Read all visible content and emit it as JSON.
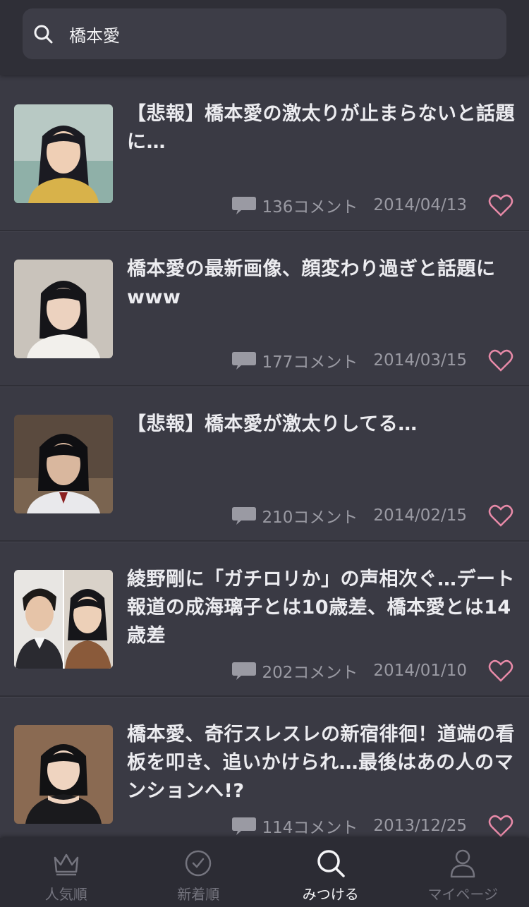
{
  "search": {
    "query": "橋本愛"
  },
  "articles": [
    {
      "title": "【悲報】橋本愛の激太りが止まらないと話題に…",
      "comments": "136コメント",
      "date": "2014/04/13"
    },
    {
      "title": "橋本愛の最新画像、顔変わり過ぎと話題にwww",
      "comments": "177コメント",
      "date": "2014/03/15"
    },
    {
      "title": "【悲報】橋本愛が激太りしてる…",
      "comments": "210コメント",
      "date": "2014/02/15"
    },
    {
      "title": "綾野剛に「ガチロリか」の声相次ぐ…デート報道の成海璃子とは10歳差、橋本愛とは14歳差",
      "comments": "202コメント",
      "date": "2014/01/10"
    },
    {
      "title": "橋本愛、奇行スレスレの新宿徘徊！道端の看板を叩き、追いかけられ…最後はあの人のマンションへ!?",
      "comments": "114コメント",
      "date": "2013/12/25"
    }
  ],
  "tabs": [
    {
      "label": "人気順",
      "icon": "crown-icon",
      "active": false
    },
    {
      "label": "新着順",
      "icon": "clock-icon",
      "active": false
    },
    {
      "label": "みつける",
      "icon": "search-icon",
      "active": true
    },
    {
      "label": "マイページ",
      "icon": "person-icon",
      "active": false
    }
  ],
  "colors": {
    "background": "#3a3a44",
    "header": "#2f2f37",
    "heart": "#e88aa8",
    "meta": "#9a9aa3",
    "active_tab": "#f5f5f7",
    "inactive_tab": "#74747e"
  }
}
